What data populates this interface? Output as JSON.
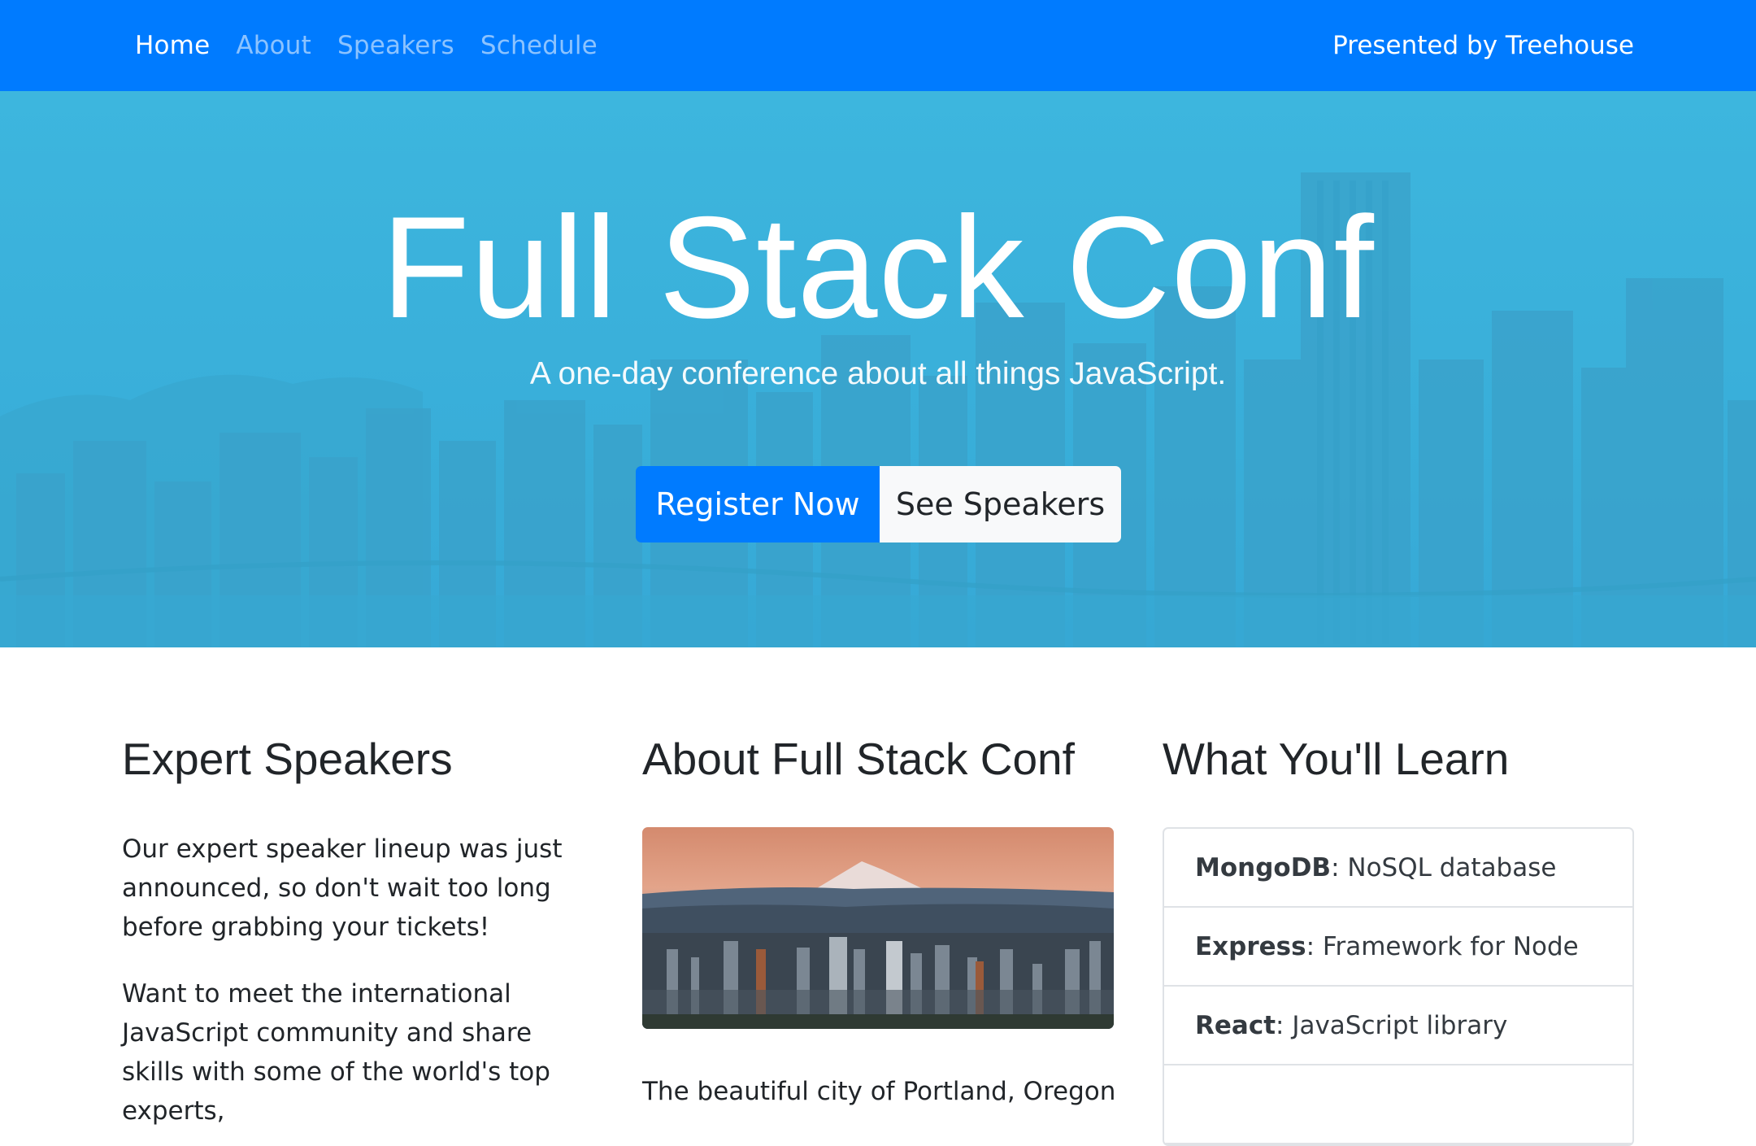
{
  "nav": {
    "items": [
      {
        "label": "Home",
        "active": true
      },
      {
        "label": "About",
        "active": false
      },
      {
        "label": "Speakers",
        "active": false
      },
      {
        "label": "Schedule",
        "active": false
      }
    ],
    "presented_by": "Presented by Treehouse",
    "background": "#007bff"
  },
  "hero": {
    "title": "Full Stack Conf",
    "subtitle": "A one-day conference about all things JavaScript.",
    "primary_button": "Register Now",
    "secondary_button": "See Speakers",
    "overlay_color": "#3db3dc"
  },
  "columns": {
    "speakers": {
      "heading": "Expert Speakers",
      "paragraph1": "Our expert speaker lineup was just announced, so don't wait too long before grabbing your tickets!",
      "paragraph2": "Want to meet the international JavaScript community and share skills with some of the world's top experts,"
    },
    "about": {
      "heading": "About Full Stack Conf",
      "paragraph": "The beautiful city of Portland, Oregon"
    },
    "learn": {
      "heading": "What You'll Learn",
      "items": [
        {
          "term": "MongoDB",
          "desc": ": NoSQL database"
        },
        {
          "term": "Express",
          "desc": ": Framework for Node"
        },
        {
          "term": "React",
          "desc": ": JavaScript library"
        }
      ]
    }
  }
}
